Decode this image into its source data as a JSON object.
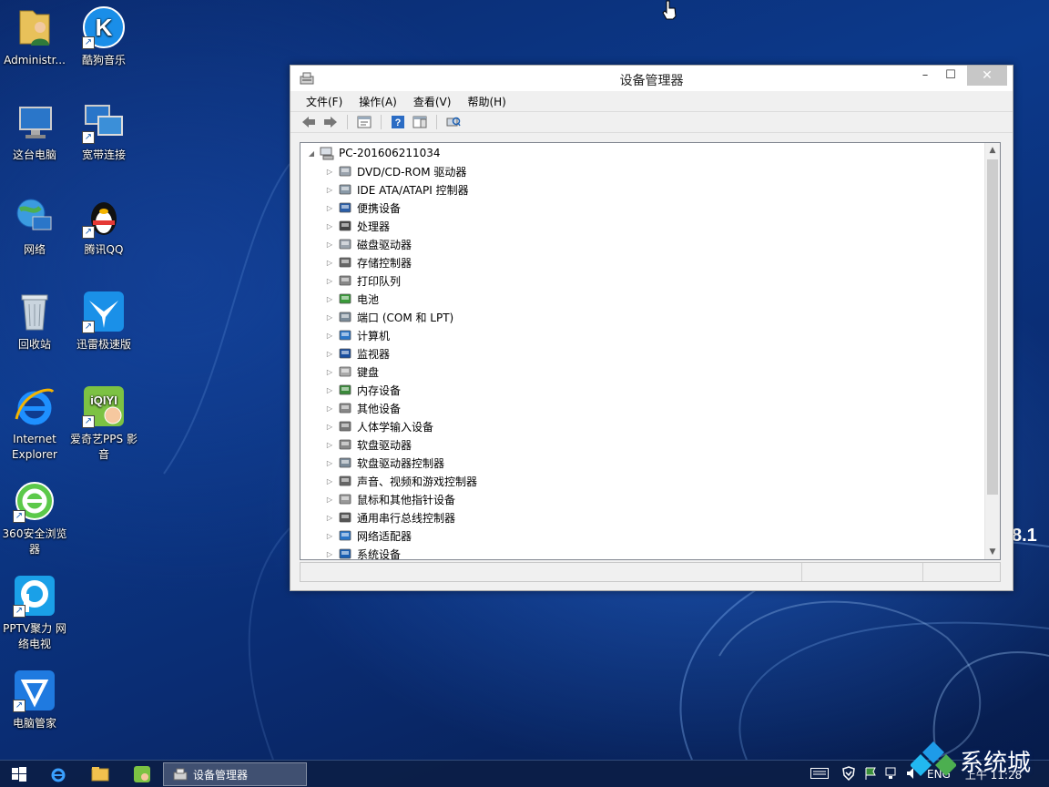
{
  "desktop": {
    "icons": [
      {
        "label": "Administr..."
      },
      {
        "label": "酷狗音乐"
      },
      {
        "label": "这台电脑"
      },
      {
        "label": "宽带连接"
      },
      {
        "label": "网络"
      },
      {
        "label": "腾讯QQ"
      },
      {
        "label": "回收站"
      },
      {
        "label": "迅雷极速版"
      },
      {
        "label": "Internet Explorer"
      },
      {
        "label": "爱奇艺PPS 影音"
      },
      {
        "label": "360安全浏览器"
      },
      {
        "label": "PPTV聚力 网络电视"
      },
      {
        "label": "电脑管家"
      }
    ],
    "version_text": "8.1"
  },
  "window": {
    "title": "设备管理器",
    "controls": {
      "minimize": "–",
      "maximize": "☐",
      "close": "✕"
    },
    "menu": [
      "文件(F)",
      "操作(A)",
      "查看(V)",
      "帮助(H)"
    ],
    "toolbar": [
      "back-icon",
      "forward-icon",
      "properties-icon",
      "help-icon",
      "show-hide-icon",
      "scan-hardware-icon"
    ],
    "tree": {
      "root": "PC-201606211034",
      "items": [
        {
          "label": "DVD/CD-ROM 驱动器",
          "icon": "dvd-drive-icon"
        },
        {
          "label": "IDE ATA/ATAPI 控制器",
          "icon": "ide-controller-icon"
        },
        {
          "label": "便携设备",
          "icon": "portable-device-icon"
        },
        {
          "label": "处理器",
          "icon": "processor-icon"
        },
        {
          "label": "磁盘驱动器",
          "icon": "disk-drive-icon"
        },
        {
          "label": "存储控制器",
          "icon": "storage-controller-icon"
        },
        {
          "label": "打印队列",
          "icon": "printer-icon"
        },
        {
          "label": "电池",
          "icon": "battery-icon"
        },
        {
          "label": "端口 (COM 和 LPT)",
          "icon": "port-icon"
        },
        {
          "label": "计算机",
          "icon": "computer-icon"
        },
        {
          "label": "监视器",
          "icon": "monitor-icon"
        },
        {
          "label": "键盘",
          "icon": "keyboard-icon"
        },
        {
          "label": "内存设备",
          "icon": "memory-icon"
        },
        {
          "label": "其他设备",
          "icon": "unknown-device-icon"
        },
        {
          "label": "人体学输入设备",
          "icon": "hid-icon"
        },
        {
          "label": "软盘驱动器",
          "icon": "floppy-drive-icon"
        },
        {
          "label": "软盘驱动器控制器",
          "icon": "floppy-controller-icon"
        },
        {
          "label": "声音、视频和游戏控制器",
          "icon": "sound-icon"
        },
        {
          "label": "鼠标和其他指针设备",
          "icon": "mouse-icon"
        },
        {
          "label": "通用串行总线控制器",
          "icon": "usb-icon"
        },
        {
          "label": "网络适配器",
          "icon": "network-adapter-icon"
        },
        {
          "label": "系统设备",
          "icon": "system-device-icon"
        }
      ]
    }
  },
  "taskbar": {
    "active_task": "设备管理器",
    "tray": {
      "lang": "ENG",
      "time": "上午 11:28"
    }
  },
  "watermark": "系统城"
}
